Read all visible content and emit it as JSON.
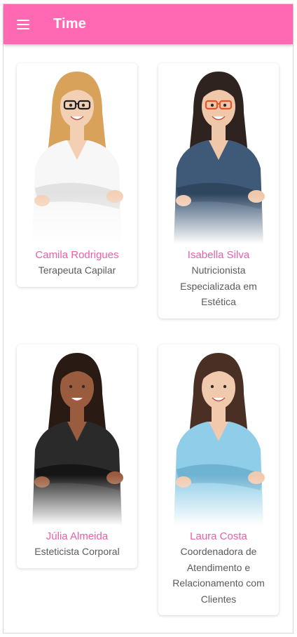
{
  "header": {
    "title": "Time",
    "accent_color": "#ff69b4",
    "menu_icon": "hamburger-menu-icon"
  },
  "team": [
    {
      "name": "Camila Rodrigues",
      "role": "Terapeuta Capilar",
      "photo": {
        "skin": "#f3cfb4",
        "hair": "#d8a25b",
        "top": "#f7f7f7",
        "top_shade": "#e2e2e2",
        "glasses": "#222222"
      }
    },
    {
      "name": "Isabella Silva",
      "role": "Nutricionista Especializada em Estética",
      "photo": {
        "skin": "#efc7a9",
        "hair": "#2f2320",
        "top": "#3f5a78",
        "top_shade": "#2f465f",
        "glasses": "#e5542a"
      }
    },
    {
      "name": "Júlia Almeida",
      "role": "Esteticista Corporal",
      "photo": {
        "skin": "#9a5c3e",
        "hair": "#2a1a14",
        "top": "#2a2a2a",
        "top_shade": "#151515",
        "glasses": ""
      }
    },
    {
      "name": "Laura Costa",
      "role": "Coordenadora de Atendimento e Relacionamento com Clientes",
      "photo": {
        "skin": "#f1c9ac",
        "hair": "#4a3024",
        "top": "#8fcde8",
        "top_shade": "#6fb3d2",
        "glasses": ""
      }
    }
  ]
}
